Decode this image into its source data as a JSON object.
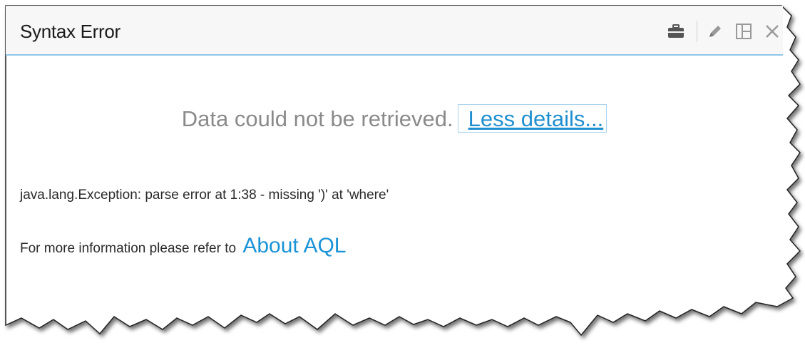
{
  "window": {
    "title": "Syntax Error"
  },
  "toolbar": {
    "icons": [
      "briefcase-icon",
      "pencil-icon",
      "layout-icon",
      "close-icon"
    ]
  },
  "content": {
    "message": "Data could not be retrieved.",
    "less_details_label": "Less details...",
    "exception_text": "java.lang.Exception: parse error at 1:38 - missing ')' at 'where'",
    "more_info_prefix": "For more information please refer to",
    "about_link_label": "About AQL"
  },
  "colors": {
    "accent": "#1a93d6",
    "titlebar_border": "#8fc7e8",
    "message_gray": "#8a8a8a"
  }
}
